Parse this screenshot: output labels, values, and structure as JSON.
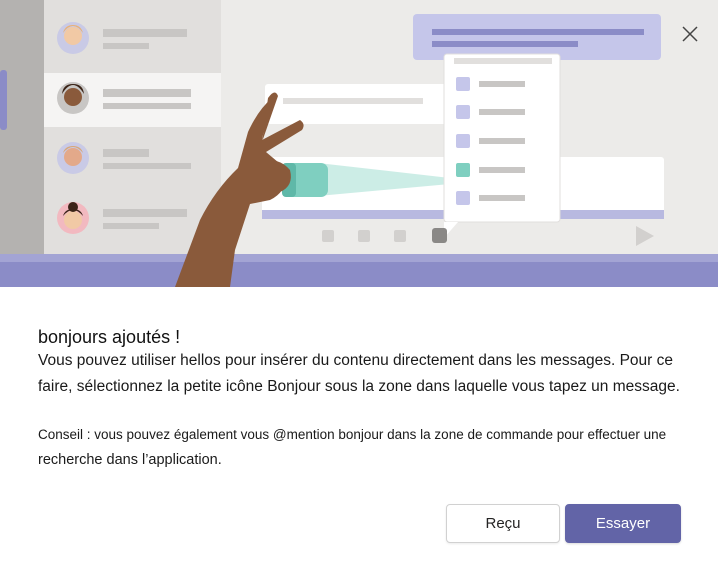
{
  "dialog": {
    "title": "bonjours ajoutés !",
    "description": "Vous pouvez utiliser hellos pour insérer du contenu directement dans les messages. Pour ce faire, sélectionnez la petite icône Bonjour sous la zone dans laquelle vous tapez un message.",
    "tip_line1": "Conseil : vous pouvez également vous @mention bonjour dans la zone de commande pour effectuer une",
    "tip_line2": "recherche dans l’application.",
    "secondary_button": "Reçu",
    "primary_button": "Essayer"
  },
  "colors": {
    "accent": "#6264a7",
    "accent_light": "#c5c6ea",
    "teal": "#7fcfc0",
    "illustration_bg": "#ecebe9",
    "sidebar_bg": "#e1dfdd"
  },
  "icons": {
    "close": "close-icon"
  }
}
